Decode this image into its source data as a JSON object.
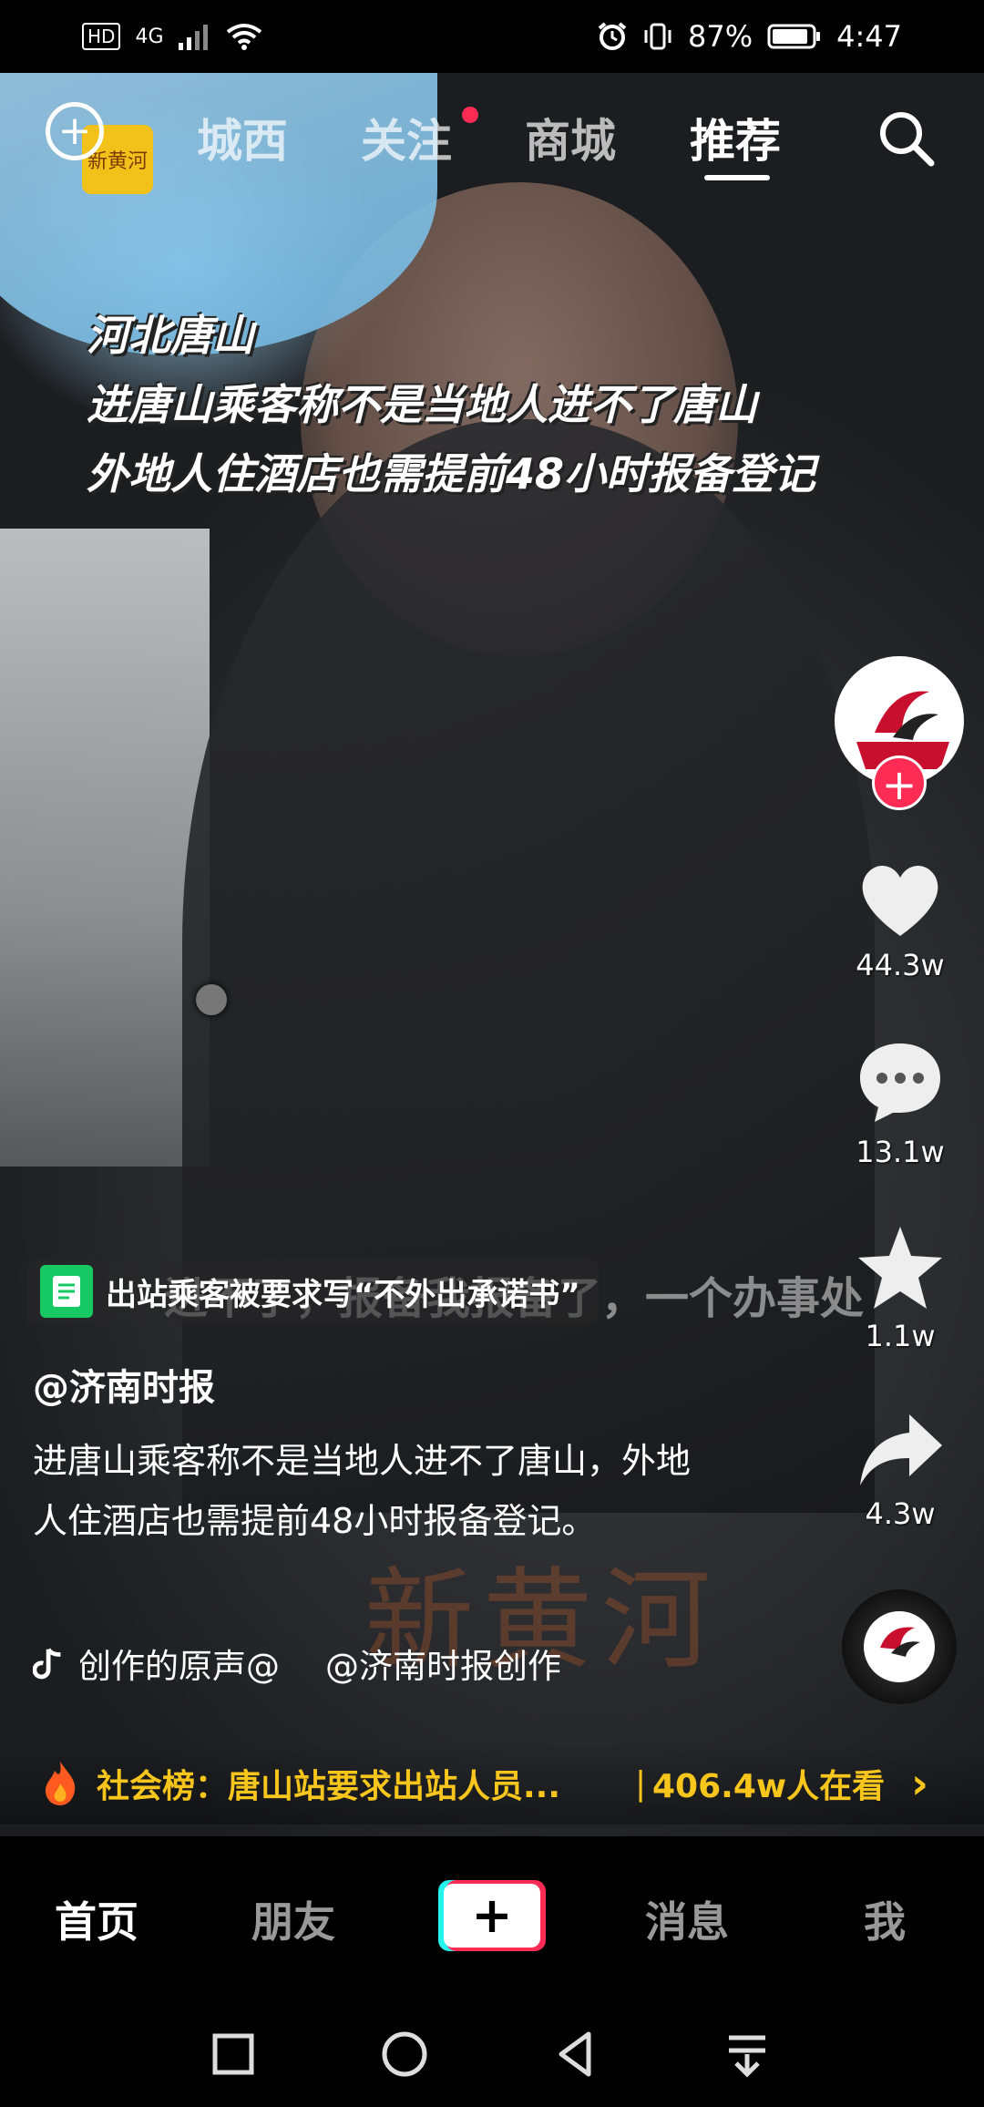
{
  "status_bar": {
    "hd": "HD",
    "network": "4G",
    "battery_percent": "87%",
    "time": "4:47"
  },
  "top_nav": {
    "logo_text": "新黄河",
    "tabs": [
      {
        "label": "城西",
        "active": false
      },
      {
        "label": "关注",
        "active": false,
        "has_dot": true
      },
      {
        "label": "商城",
        "active": false
      },
      {
        "label": "推荐",
        "active": true
      }
    ]
  },
  "video": {
    "overlay_lines": [
      "河北唐山",
      "进唐山乘客称不是当地人进不了唐山",
      "外地人住酒店也需提前48小时报备登记"
    ],
    "subtitle": "进不了，报备我报备了，一个办事处",
    "watermark": "新黄河"
  },
  "tag_chip": {
    "text": "出站乘客被要求写“不外出承诺书”"
  },
  "right_rail": {
    "likes": "44.3w",
    "comments": "13.1w",
    "favorites": "1.1w",
    "shares": "4.3w"
  },
  "post": {
    "author": "@济南时报",
    "description": "进唐山乘客称不是当地人进不了唐山，外地人住酒店也需提前48小时报备登记。",
    "music_part1": "@济南时报创作的原声",
    "music_part2": "@济南时报创作"
  },
  "hot_bar": {
    "label": "社会榜：唐山站要求出站人员...",
    "watching": "406.4w人在看"
  },
  "bottom_tabs": {
    "home": "首页",
    "friends": "朋友",
    "create": "+",
    "messages": "消息",
    "me": "我"
  },
  "colors": {
    "accent_red": "#fe2c55",
    "accent_cyan": "#25f4ee",
    "hot_yellow": "#f7c51b",
    "tag_green": "#17c964"
  }
}
